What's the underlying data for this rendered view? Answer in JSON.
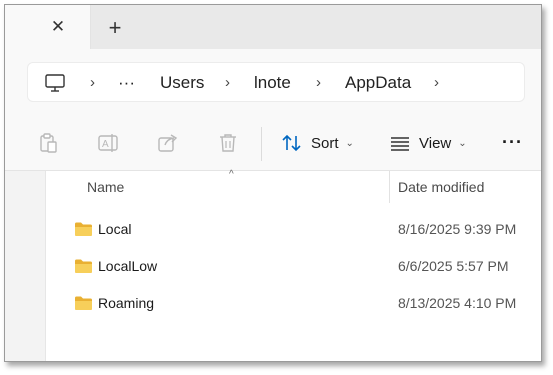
{
  "tabs": {
    "close_symbol": "✕",
    "new_tab_symbol": "+"
  },
  "breadcrumb": {
    "root_icon": "this-pc-icon",
    "separator": "›",
    "overflow": "···",
    "items": [
      "Users",
      "lnote",
      "AppData"
    ]
  },
  "toolbar": {
    "paste_icon": "clipboard-icon",
    "rename_icon": "rename-icon",
    "share_icon": "share-icon",
    "delete_icon": "trash-icon",
    "sort_label": "Sort",
    "view_label": "View",
    "more_symbol": "···",
    "chevron": "⌄"
  },
  "columns": {
    "name": "Name",
    "date_modified": "Date modified",
    "sort_indicator": "^"
  },
  "files": [
    {
      "name": "Local",
      "date": "8/16/2025 9:39 PM",
      "icon": "folder-icon"
    },
    {
      "name": "LocalLow",
      "date": "6/6/2025 5:57 PM",
      "icon": "folder-icon"
    },
    {
      "name": "Roaming",
      "date": "8/13/2025 4:10 PM",
      "icon": "folder-icon"
    }
  ],
  "colors": {
    "folder": "#f4c542",
    "accent": "#0067c0"
  }
}
